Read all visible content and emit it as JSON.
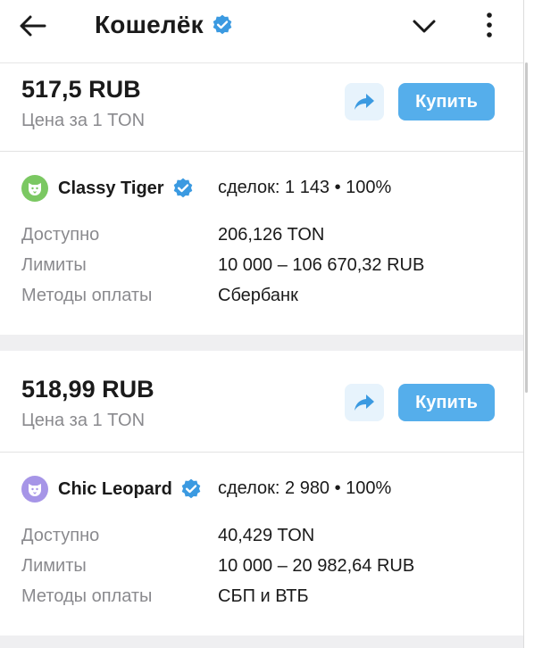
{
  "header": {
    "title": "Кошелёк",
    "icons": [
      "back-arrow-icon",
      "verified-badge-icon",
      "chevron-down-icon",
      "more-vertical-icon"
    ]
  },
  "colors": {
    "accent": "#55aeeb",
    "share_bg": "#e7f3fc",
    "verified": "#3b9ae1",
    "muted_text": "#8a8a8e"
  },
  "offers": [
    {
      "price": "517,5 RUB",
      "price_note": "Цена за 1 TON",
      "buy_label": "Купить",
      "merchant": {
        "name": "Classy Tiger",
        "avatar_color": "#7bc862",
        "stats": "сделок: 1 143 • 100%"
      },
      "rows": [
        {
          "label": "Доступно",
          "value": "206,126 TON"
        },
        {
          "label": "Лимиты",
          "value": "10 000 – 106 670,32 RUB"
        },
        {
          "label": "Методы оплаты",
          "value": "Сбербанк"
        }
      ]
    },
    {
      "price": "518,99 RUB",
      "price_note": "Цена за 1 TON",
      "buy_label": "Купить",
      "merchant": {
        "name": "Chic Leopard",
        "avatar_color": "#a695e7",
        "stats": "сделок: 2 980 • 100%"
      },
      "rows": [
        {
          "label": "Доступно",
          "value": "40,429 TON"
        },
        {
          "label": "Лимиты",
          "value": "10 000 – 20 982,64 RUB"
        },
        {
          "label": "Методы оплаты",
          "value": "СБП и ВТБ"
        }
      ]
    }
  ]
}
